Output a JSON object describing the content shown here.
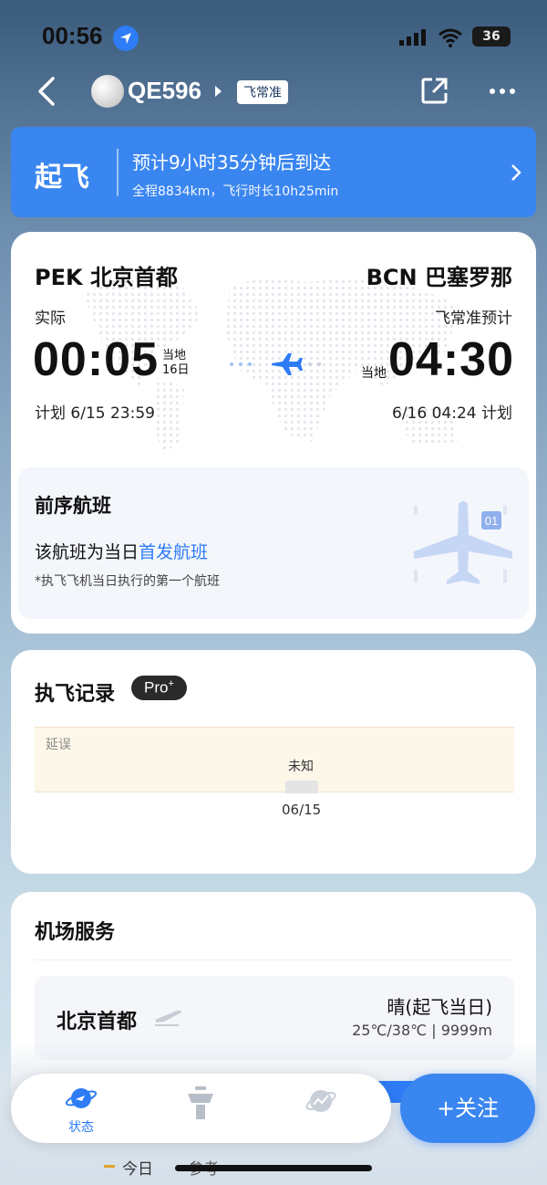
{
  "status_bar": {
    "time": "00:56",
    "battery": "36"
  },
  "nav": {
    "flight_no": "QE596",
    "brand_badge": "飞常准"
  },
  "banner": {
    "status": "起飞",
    "title": "预计9小时35分钟后到达",
    "subtitle": "全程8834km，飞行时长10h25min"
  },
  "flight": {
    "departure": {
      "route": "PEK 北京首都",
      "label": "实际",
      "time": "00:05",
      "local_label": "当地",
      "day_label": "16日",
      "plan": "计划 6/15 23:59"
    },
    "arrival": {
      "route": "BCN 巴塞罗那",
      "label": "飞常准预计",
      "time": "04:30",
      "local_label": "当地",
      "plan": "6/16 04:24 计划"
    },
    "previous": {
      "title": "前序航班",
      "text_prefix": "该航班为当日",
      "text_highlight": "首发航班",
      "note": "*执飞飞机当日执行的第一个航班",
      "plane_badge": "01"
    }
  },
  "history": {
    "title": "执飞记录",
    "pro_badge": "Pro",
    "pro_sup": "+",
    "delay_label": "延误",
    "unknown_label": "未知",
    "date": "06/15"
  },
  "airport_service": {
    "title": "机场服务",
    "airport_name": "北京首都",
    "weather": "晴(起飞当日)",
    "weather_detail": "25℃/38℃ | 9999m"
  },
  "peek": {
    "today": "今日",
    "reference": "参考"
  },
  "tab_bar": {
    "status_label": "状态"
  },
  "follow_button": "+关注",
  "colors": {
    "accent": "#3a86f0",
    "dark_badge": "#2a2a2a",
    "delay_band": "#fdf7ea"
  }
}
